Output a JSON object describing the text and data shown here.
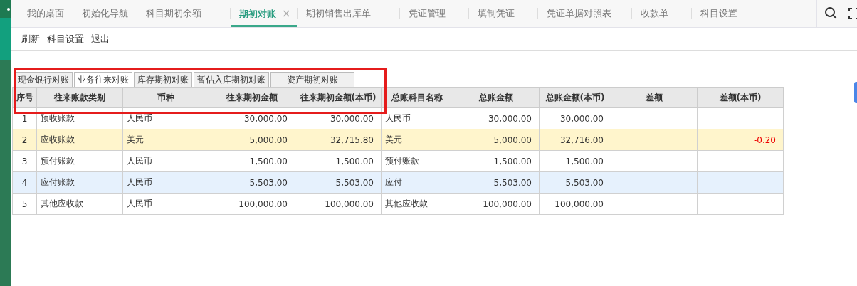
{
  "tabs": [
    {
      "label": "我的桌面",
      "selected": false
    },
    {
      "label": "初始化导航",
      "selected": false
    },
    {
      "label": "科目期初余额",
      "selected": false
    },
    {
      "label": "期初对账",
      "selected": true,
      "close": "×"
    },
    {
      "label": "期初销售出库单",
      "selected": false
    },
    {
      "label": "凭证管理",
      "selected": false
    },
    {
      "label": "填制凭证",
      "selected": false
    },
    {
      "label": "凭证单据对照表",
      "selected": false
    },
    {
      "label": "收款单",
      "selected": false
    },
    {
      "label": "科目设置",
      "selected": false
    }
  ],
  "toolbar": [
    "刷新",
    "科目设置",
    "退出"
  ],
  "sub_tabs": [
    {
      "label": "现金银行对账",
      "selected": false
    },
    {
      "label": "业务往来对账",
      "selected": true
    },
    {
      "label": "库存期初对账",
      "selected": false
    },
    {
      "label": "暂估入库期初对账",
      "selected": false
    },
    {
      "label": "资产期初对账",
      "selected": false
    }
  ],
  "table": {
    "columns": [
      "序号",
      "往来账款类别",
      "币种",
      "往来期初金额",
      "往来期初金额(本币)",
      "总账科目名称",
      "总账金额",
      "总账金额(本币)",
      "差额",
      "差额(本币)"
    ],
    "rows": [
      {
        "selected": false,
        "hovered": false,
        "cells": [
          "1",
          "预收账款",
          "人民币",
          "30,000.00",
          "30,000.00",
          "人民币",
          "30,000.00",
          "30,000.00",
          "",
          ""
        ]
      },
      {
        "selected": true,
        "hovered": false,
        "cells": [
          "2",
          "应收账款",
          "美元",
          "5,000.00",
          "32,715.80",
          "美元",
          "5,000.00",
          "32,716.00",
          "",
          "-0.20"
        ]
      },
      {
        "selected": false,
        "hovered": false,
        "cells": [
          "3",
          "预付账款",
          "人民币",
          "1,500.00",
          "1,500.00",
          "预付账款",
          "1,500.00",
          "1,500.00",
          "",
          ""
        ]
      },
      {
        "selected": false,
        "hovered": true,
        "cells": [
          "4",
          "应付账款",
          "人民币",
          "5,503.00",
          "5,503.00",
          "应付",
          "5,503.00",
          "5,503.00",
          "",
          ""
        ]
      },
      {
        "selected": false,
        "hovered": false,
        "cells": [
          "5",
          "其他应收款",
          "人民币",
          "100,000.00",
          "100,000.00",
          "其他应收款",
          "100,000.00",
          "100,000.00",
          "",
          ""
        ]
      }
    ]
  }
}
